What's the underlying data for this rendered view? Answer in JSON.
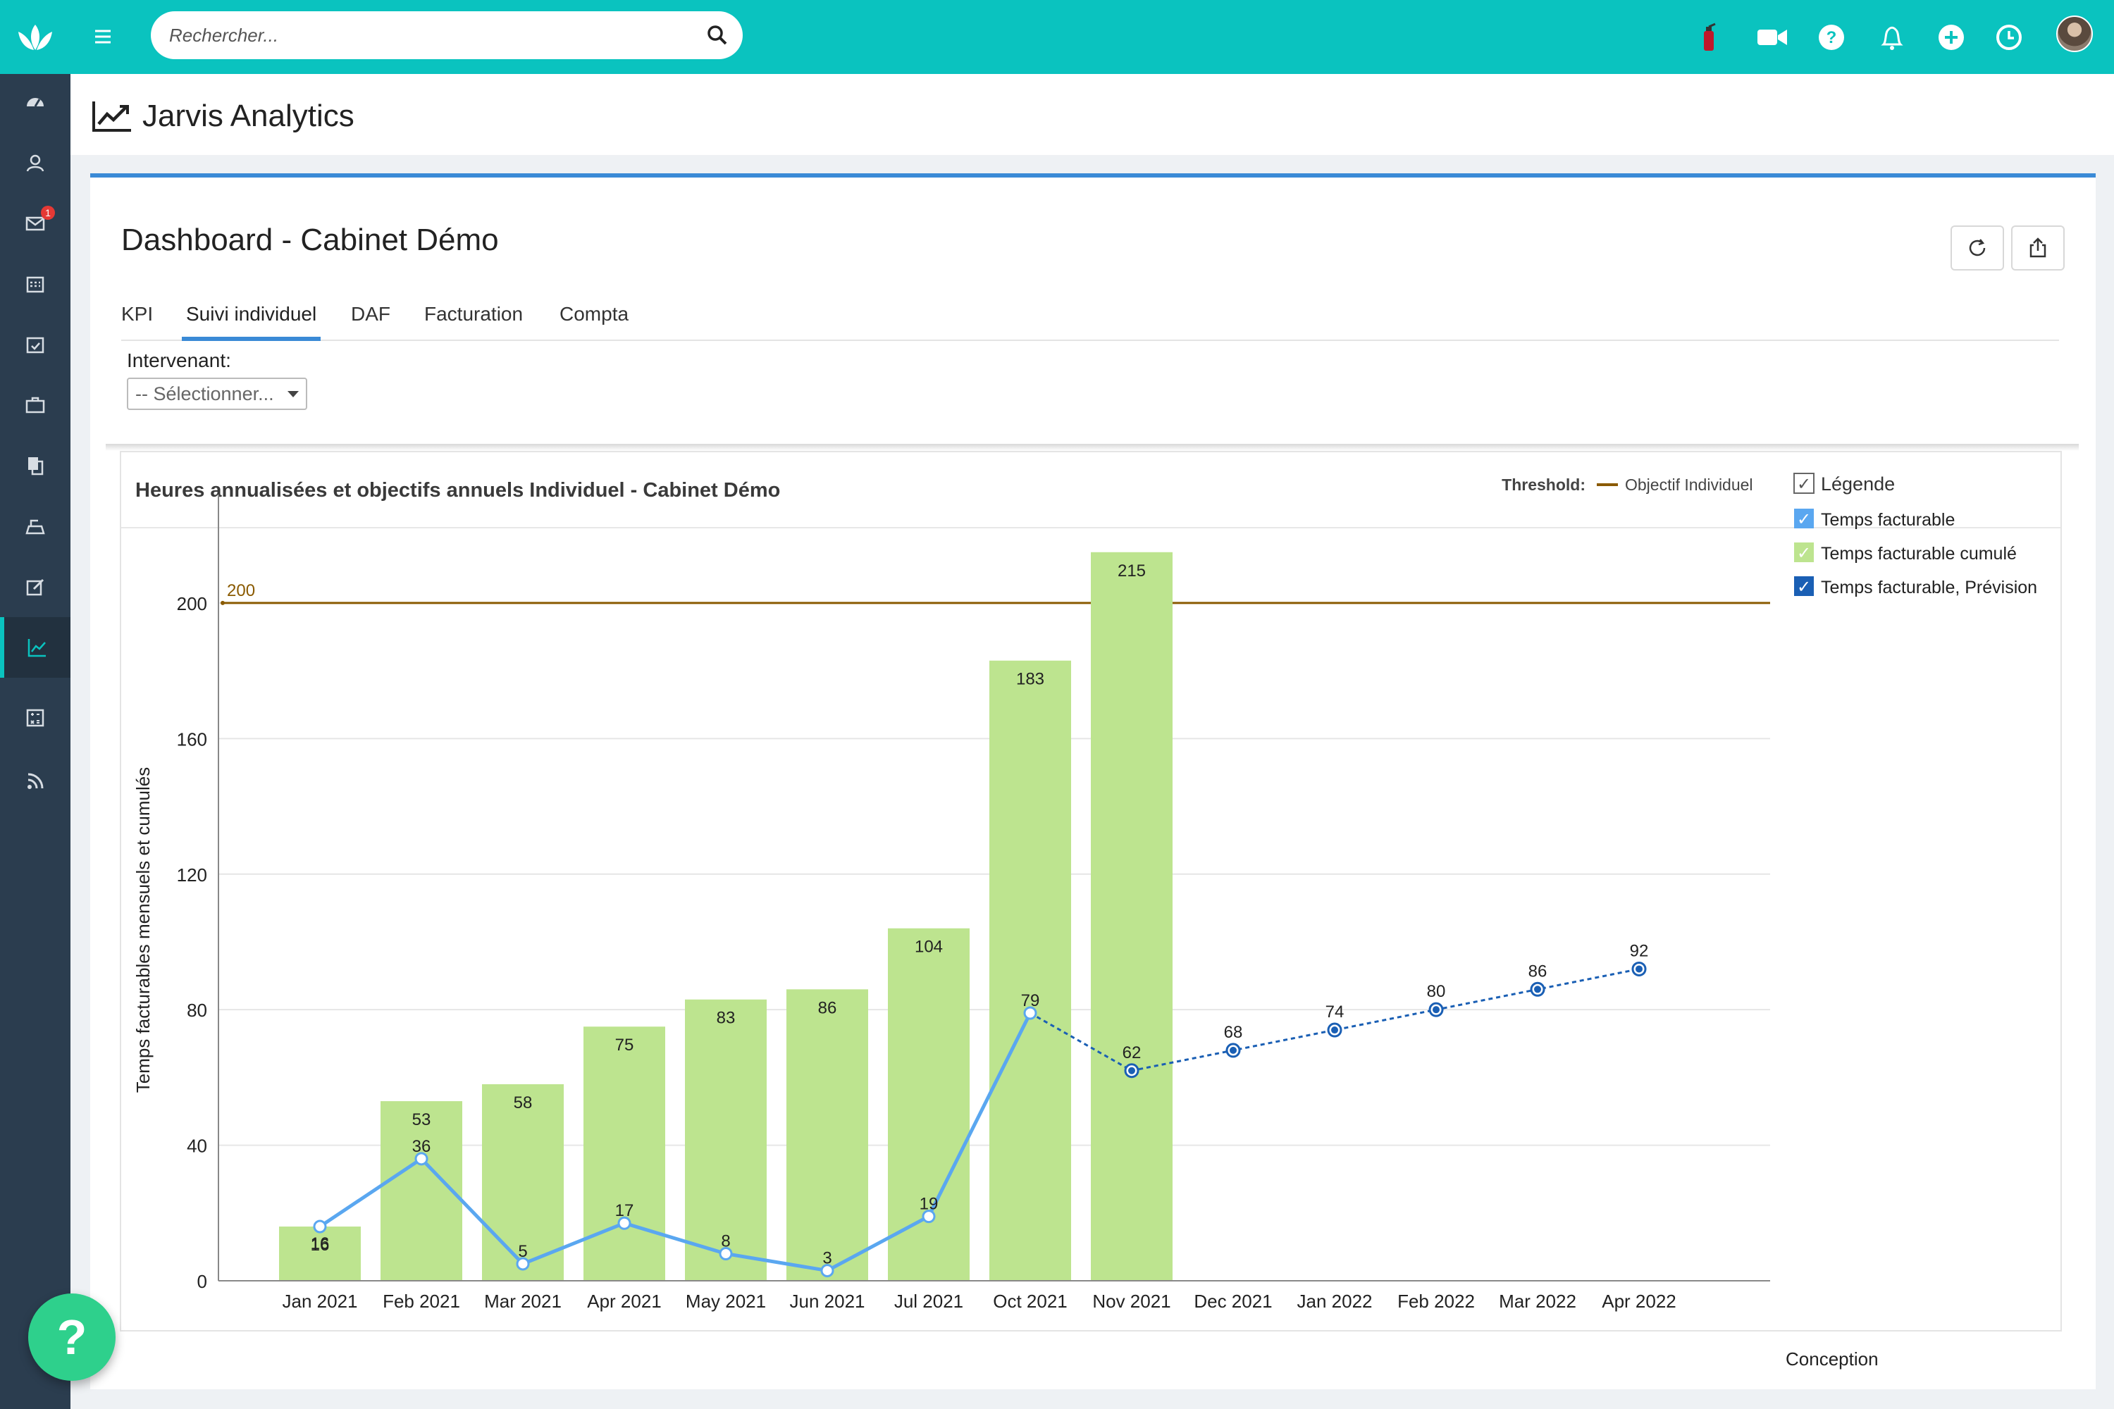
{
  "app": {
    "name": "Jarvis Analytics"
  },
  "search": {
    "placeholder": "Rechercher..."
  },
  "sidebar": {
    "items": [
      {
        "name": "dashboard",
        "icon": "speedometer-icon"
      },
      {
        "name": "contacts",
        "icon": "contacts-icon"
      },
      {
        "name": "messages",
        "icon": "mail-icon",
        "badge": "1"
      },
      {
        "name": "calendar",
        "icon": "calendar-icon"
      },
      {
        "name": "tasks",
        "icon": "calendar-check-icon"
      },
      {
        "name": "cases",
        "icon": "briefcase-icon"
      },
      {
        "name": "documents",
        "icon": "documents-icon"
      },
      {
        "name": "billing",
        "icon": "cash-register-icon"
      },
      {
        "name": "edit",
        "icon": "edit-icon"
      },
      {
        "name": "analytics",
        "icon": "chart-line-icon",
        "active": true
      },
      {
        "name": "calculator",
        "icon": "calculator-icon"
      },
      {
        "name": "feed",
        "icon": "rss-icon"
      }
    ]
  },
  "topbar": {
    "icons": [
      "fire-extinguisher-icon",
      "video-icon",
      "help-circle-icon",
      "bell-icon",
      "plus-circle-icon",
      "clock-icon",
      "avatar"
    ]
  },
  "dashboard": {
    "title": "Dashboard - Cabinet Démo",
    "tabs": [
      {
        "label": "KPI",
        "active": false
      },
      {
        "label": "Suivi individuel",
        "active": true
      },
      {
        "label": "DAF",
        "active": false
      },
      {
        "label": "Facturation",
        "active": false
      },
      {
        "label": "Compta",
        "active": false
      }
    ],
    "filter": {
      "label": "Intervenant:",
      "selected": "-- Sélectionner..."
    }
  },
  "chart_data": {
    "type": "bar",
    "title": "Heures annualisées et objectifs annuels Individuel - Cabinet Démo",
    "ylabel": "Temps facturables mensuels et cumulés",
    "xlabel": "",
    "ylim": [
      0,
      232
    ],
    "yticks": [
      0,
      40,
      80,
      120,
      160,
      200
    ],
    "grid": true,
    "categories": [
      "Jan 2021",
      "Feb 2021",
      "Mar 2021",
      "Apr 2021",
      "May 2021",
      "Jun 2021",
      "Jul 2021",
      "Oct 2021",
      "Nov 2021",
      "Dec 2021",
      "Jan 2022",
      "Feb 2022",
      "Mar 2022",
      "Apr 2022"
    ],
    "threshold": {
      "label": "Threshold:",
      "name": "Objectif Individuel",
      "value": 200,
      "value_label": "200",
      "color": "#8a5a00"
    },
    "series": [
      {
        "name": "Temps facturable cumulé",
        "type": "bar",
        "color": "#bde48f",
        "values": [
          16,
          53,
          58,
          75,
          83,
          86,
          104,
          183,
          215,
          null,
          null,
          null,
          null,
          null
        ]
      },
      {
        "name": "Temps facturable",
        "type": "line",
        "color": "#5aa7f0",
        "values": [
          16,
          36,
          5,
          17,
          8,
          3,
          19,
          79,
          null,
          null,
          null,
          null,
          null,
          null
        ]
      },
      {
        "name": "Temps facturable, Prévision",
        "type": "line-dashed",
        "color": "#1a5fb4",
        "values": [
          null,
          null,
          null,
          null,
          null,
          null,
          null,
          79,
          62,
          68,
          74,
          80,
          86,
          92
        ]
      }
    ],
    "legend": {
      "position": "right",
      "title": "Légende",
      "items": [
        {
          "label": "Temps facturable",
          "color": "#5aa7f0"
        },
        {
          "label": "Temps facturable cumulé",
          "color": "#bde48f"
        },
        {
          "label": "Temps facturable, Prévision",
          "color": "#1a5fb4"
        }
      ]
    }
  },
  "footer": {
    "conception": "Conception"
  },
  "help_fab": {
    "label": "?"
  }
}
